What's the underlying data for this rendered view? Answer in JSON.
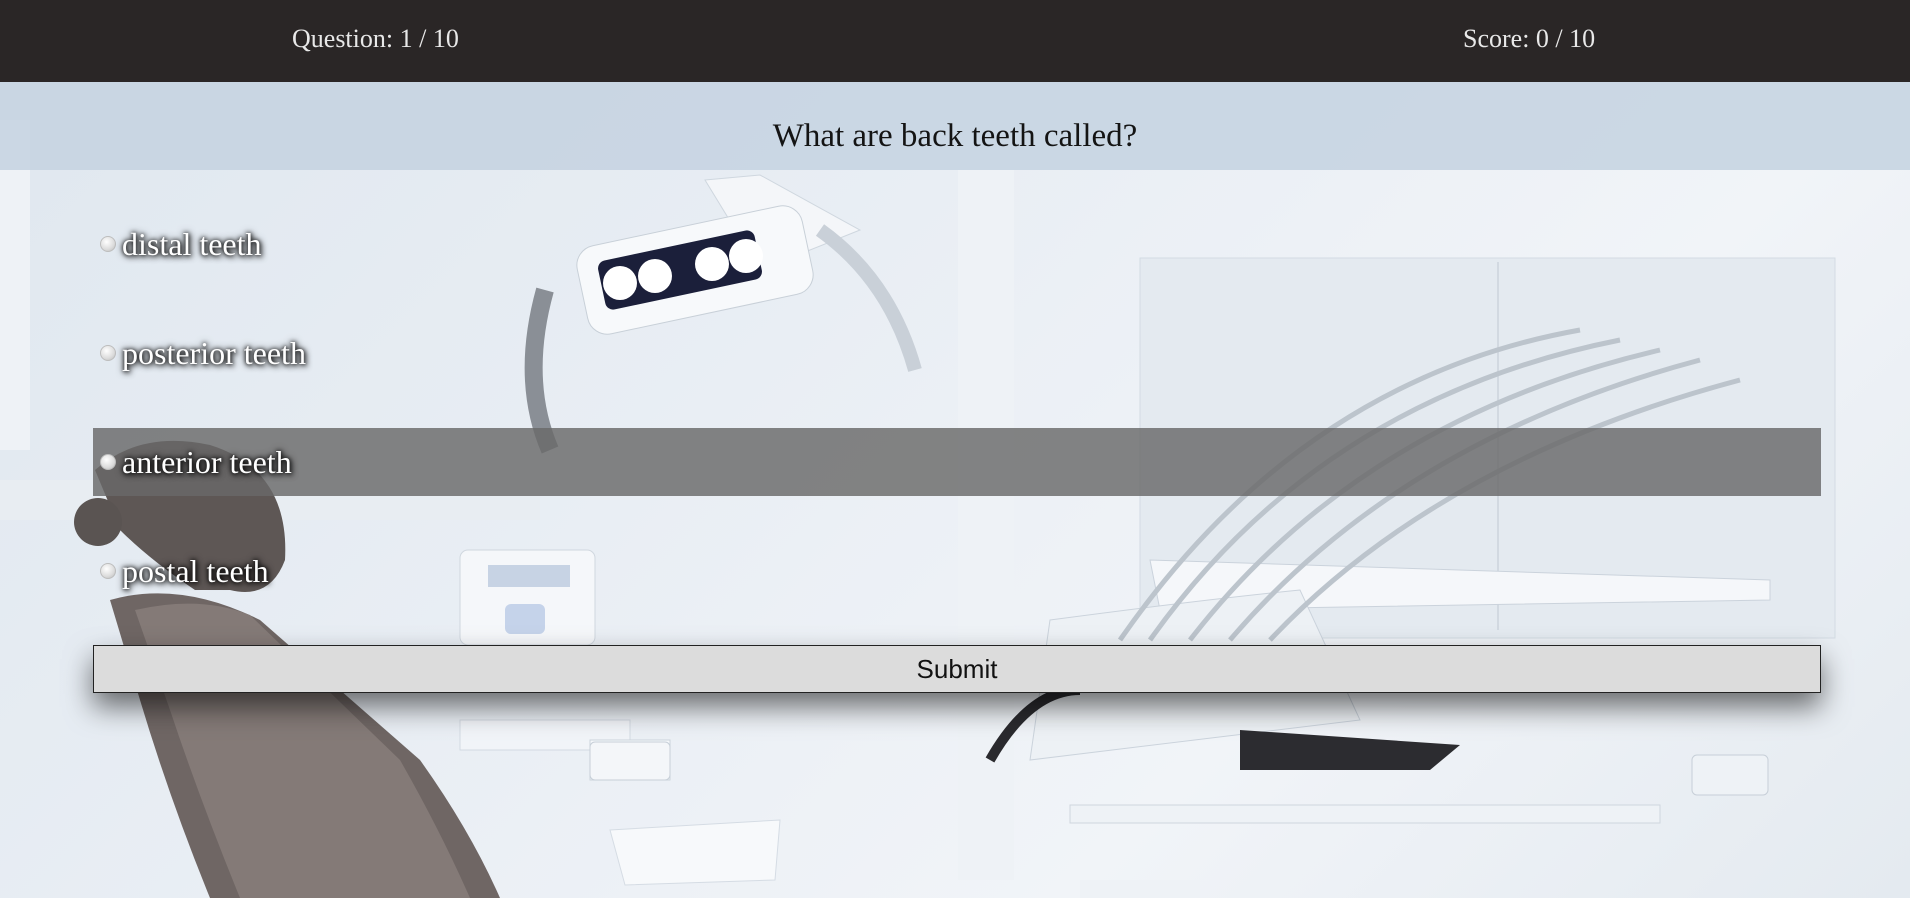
{
  "header": {
    "question_counter": "Question: 1 / 10",
    "score": "Score: 0 / 10"
  },
  "quiz": {
    "question": "What are back teeth called?",
    "options": [
      {
        "label": "distal teeth"
      },
      {
        "label": "posterior teeth"
      },
      {
        "label": "anterior teeth"
      },
      {
        "label": "postal teeth"
      }
    ],
    "hovered_option": "anterior teeth",
    "submit_label": "Submit"
  },
  "colors": {
    "topbar": "#2a2626",
    "hover_highlight": "#696969",
    "submit_bg": "#dcdcdc"
  },
  "background_image": "dental clinic with dentist chair and overhead lamp"
}
